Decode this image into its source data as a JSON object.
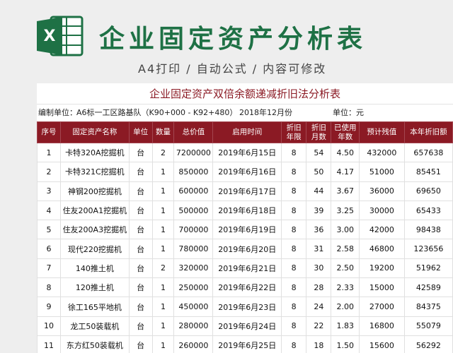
{
  "header": {
    "title": "企业固定资产分析表",
    "subtitle": "A4打印 / 自动公式 / 内容可修改",
    "logo_letter": "X"
  },
  "sheet": {
    "title": "企业固定资产双倍余额递减折旧法分析表",
    "unit_label": "编制单位：",
    "unit_value": "A6标一工区路基队（K90+000 - K92+480）",
    "date": "2018年12月份",
    "currency_label": "单位：元",
    "columns": [
      [
        "序号"
      ],
      [
        "固定资产名称"
      ],
      [
        "单位"
      ],
      [
        "数量"
      ],
      [
        "总价值"
      ],
      [
        "启用时间"
      ],
      [
        "折旧",
        "年限"
      ],
      [
        "折旧",
        "月数"
      ],
      [
        "已使用",
        "年数"
      ],
      [
        "预计残值"
      ],
      [
        "本年折旧额"
      ]
    ],
    "rows": [
      [
        "1",
        "卡特320A挖掘机",
        "台",
        "2",
        "7200000",
        "2019年6月15日",
        "8",
        "54",
        "4.50",
        "432000",
        "657638"
      ],
      [
        "2",
        "卡特321C挖掘机",
        "台",
        "1",
        "850000",
        "2019年6月16日",
        "8",
        "50",
        "4.17",
        "51000",
        "85451"
      ],
      [
        "3",
        "神钢200挖掘机",
        "台",
        "1",
        "600000",
        "2019年6月17日",
        "8",
        "44",
        "3.67",
        "36000",
        "69650"
      ],
      [
        "4",
        "住友200A1挖掘机",
        "台",
        "1",
        "500000",
        "2019年6月18日",
        "8",
        "39",
        "3.25",
        "30000",
        "65433"
      ],
      [
        "5",
        "住友200A3挖掘机",
        "台",
        "1",
        "700000",
        "2019年6月19日",
        "8",
        "36",
        "3.00",
        "42000",
        "98438"
      ],
      [
        "6",
        "现代220挖掘机",
        "台",
        "1",
        "780000",
        "2019年6月20日",
        "8",
        "31",
        "2.58",
        "46800",
        "123656"
      ],
      [
        "7",
        "140推土机",
        "台",
        "2",
        "320000",
        "2019年6月21日",
        "8",
        "30",
        "2.50",
        "19200",
        "51962"
      ],
      [
        "8",
        "120推土机",
        "台",
        "1",
        "250000",
        "2019年6月22日",
        "8",
        "28",
        "2.33",
        "15000",
        "42589"
      ],
      [
        "9",
        "徐工165平地机",
        "台",
        "1",
        "450000",
        "2019年6月23日",
        "8",
        "24",
        "2.00",
        "27000",
        "84375"
      ],
      [
        "10",
        "龙工50装载机",
        "台",
        "1",
        "280000",
        "2019年6月24日",
        "8",
        "22",
        "1.83",
        "16800",
        "55079"
      ],
      [
        "11",
        "东方红50装载机",
        "台",
        "1",
        "260000",
        "2019年6月25日",
        "8",
        "18",
        "1.50",
        "15600",
        "56292"
      ]
    ]
  }
}
